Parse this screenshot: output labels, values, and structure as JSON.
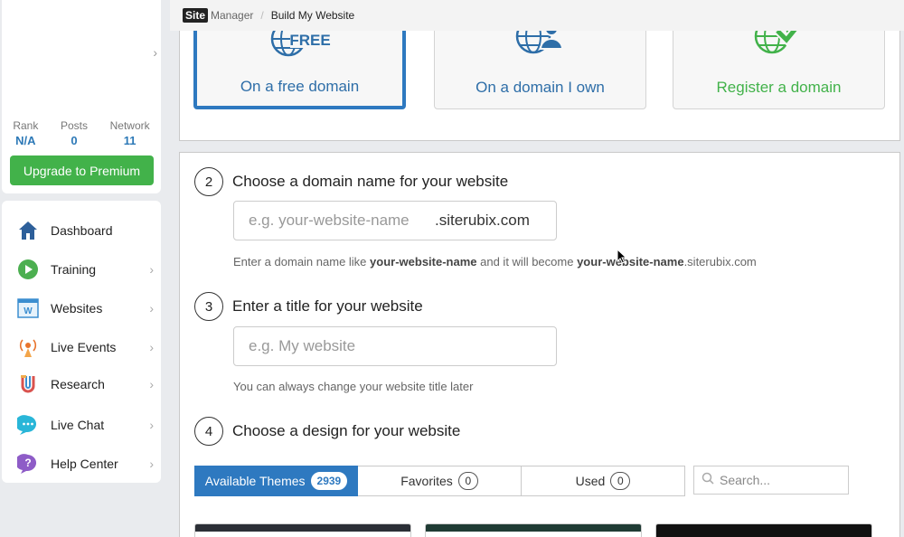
{
  "breadcrumb": {
    "logo_site": "Site",
    "logo_manager": "Manager",
    "current": "Build My Website"
  },
  "profile": {
    "stats": [
      {
        "label": "Rank",
        "value": "N/A"
      },
      {
        "label": "Posts",
        "value": "0"
      },
      {
        "label": "Network",
        "value": "11"
      }
    ],
    "upgrade_label": "Upgrade to Premium"
  },
  "nav": [
    {
      "label": "Dashboard",
      "icon": "home-icon"
    },
    {
      "label": "Training",
      "icon": "play-icon"
    },
    {
      "label": "Websites",
      "icon": "website-icon"
    },
    {
      "label": "Live Events",
      "icon": "broadcast-icon"
    },
    {
      "label": "Research",
      "icon": "research-icon"
    },
    {
      "label": "Live Chat",
      "icon": "chat-icon"
    },
    {
      "label": "Help Center",
      "icon": "help-icon"
    }
  ],
  "domain_options": [
    {
      "label": "On a free domain",
      "badge": "FREE",
      "selected": true
    },
    {
      "label": "On a domain I own",
      "selected": false
    },
    {
      "label": "Register a domain",
      "selected": false
    }
  ],
  "steps": {
    "step2": {
      "number": "2",
      "title": "Choose a domain name for your website",
      "placeholder": "e.g. your-website-name",
      "suffix": ".siterubix.com",
      "help_prefix": "Enter a domain name like ",
      "help_bold1": "your-website-name",
      "help_mid": " and it will become ",
      "help_bold2": "your-website-name",
      "help_suffix": ".siterubix.com"
    },
    "step3": {
      "number": "3",
      "title": "Enter a title for your website",
      "placeholder": "e.g. My website",
      "help": "You can always change your website title later"
    },
    "step4": {
      "number": "4",
      "title": "Choose a design for your website"
    }
  },
  "theme_tabs": [
    {
      "label": "Available Themes",
      "count": "2939"
    },
    {
      "label": "Favorites",
      "count": "0"
    },
    {
      "label": "Used",
      "count": "0"
    }
  ],
  "theme_search": {
    "placeholder": "Search..."
  },
  "colors": {
    "accent": "#2e79c0",
    "success": "#42b24a",
    "domain_text_blue": "#2e6ea8"
  }
}
